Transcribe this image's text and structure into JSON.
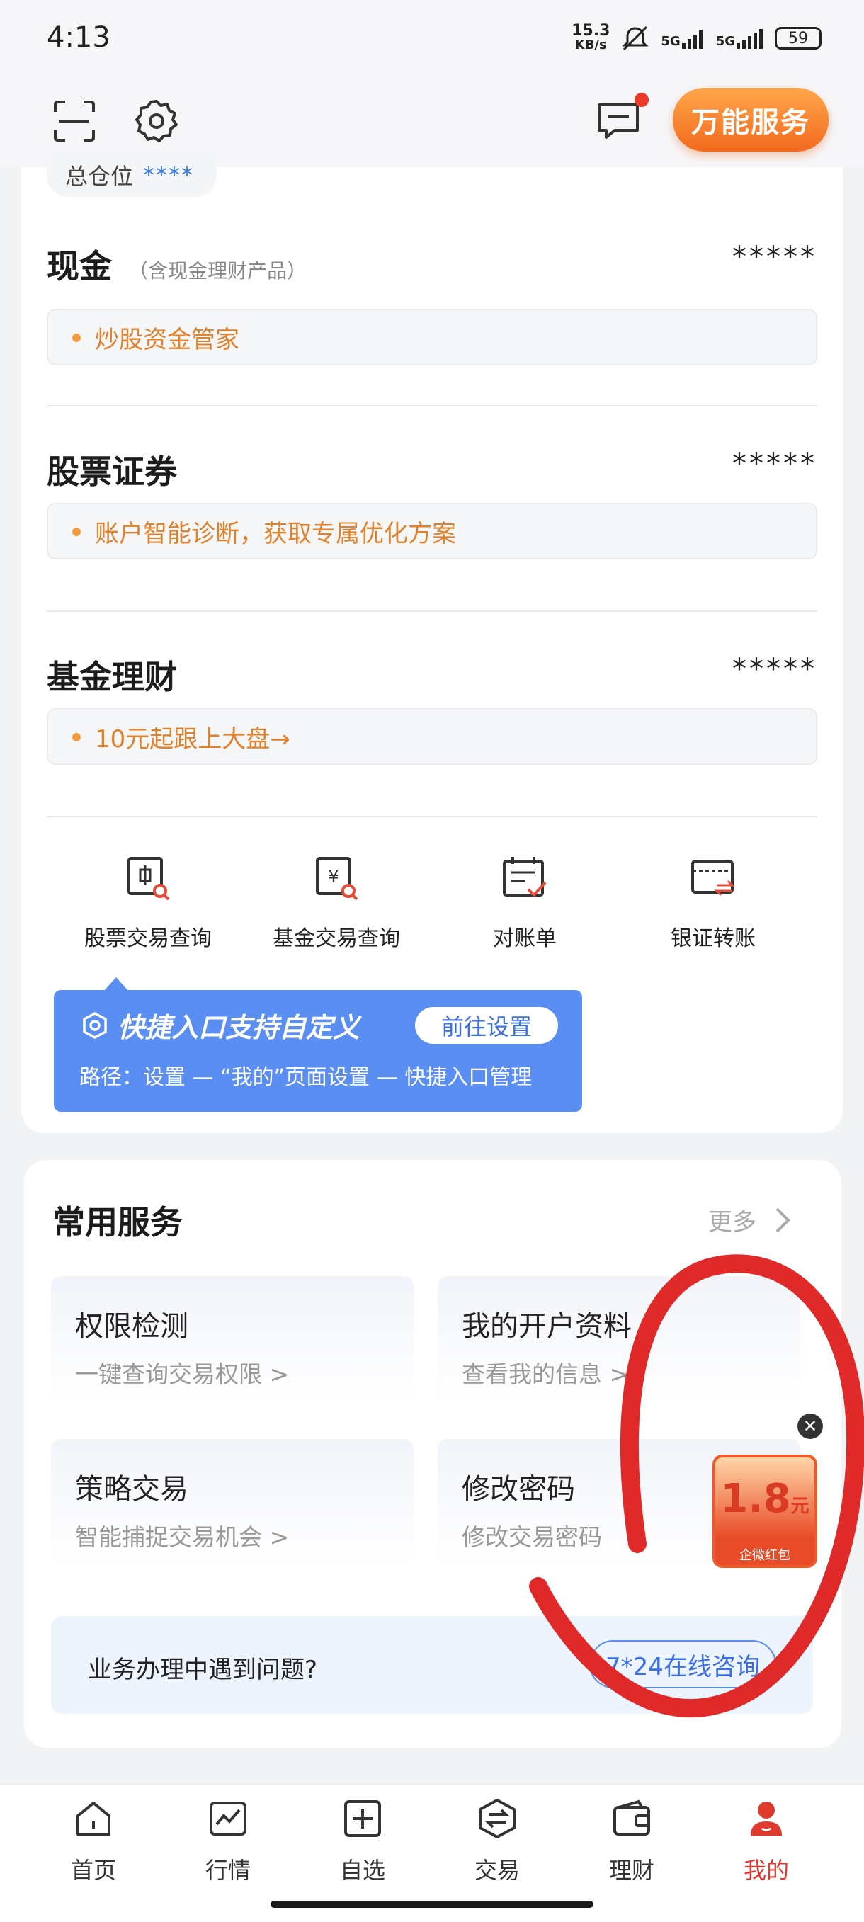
{
  "status_bar": {
    "time": "4:13",
    "net_speed_value": "15.3",
    "net_speed_unit": "KB/s",
    "signal1": "5G",
    "signal2": "5G",
    "battery": "59"
  },
  "top_bar": {
    "service_button": "万能服务"
  },
  "position_chip": {
    "label": "总仓位",
    "value": "****"
  },
  "sections": [
    {
      "title": "现金",
      "subtitle": "（含现金理财产品）",
      "value": "*****",
      "tip": "炒股资金管家"
    },
    {
      "title": "股票证券",
      "subtitle": "",
      "value": "*****",
      "tip": "账户智能诊断，获取专属优化方案"
    },
    {
      "title": "基金理财",
      "subtitle": "",
      "value": "*****",
      "tip": "10元起跟上大盘→"
    }
  ],
  "quick_entries": [
    {
      "label": "股票交易查询",
      "icon": "stock-query-icon"
    },
    {
      "label": "基金交易查询",
      "icon": "fund-query-icon"
    },
    {
      "label": "对账单",
      "icon": "statement-icon"
    },
    {
      "label": "银证转账",
      "icon": "bank-transfer-icon"
    }
  ],
  "quick_tip": {
    "title": "快捷入口支持自定义",
    "button": "前往设置",
    "path": "路径：设置 — “我的”页面设置 — 快捷入口管理"
  },
  "services": {
    "title": "常用服务",
    "more": "更多",
    "tiles": [
      {
        "title": "权限检测",
        "sub": "一键查询交易权限 >"
      },
      {
        "title": "我的开户资料",
        "sub": "查看我的信息 >"
      },
      {
        "title": "策略交易",
        "sub": "智能捕捉交易机会 >"
      },
      {
        "title": "修改密码",
        "sub": "修改交易密码"
      }
    ],
    "help_text": "业务办理中遇到问题?",
    "help_button": "7*24在线咨询"
  },
  "red_envelope": {
    "amount": "1.8",
    "unit": "元",
    "label": "企微红包"
  },
  "bottom_nav": [
    {
      "label": "首页",
      "icon": "home-icon",
      "active": false
    },
    {
      "label": "行情",
      "icon": "market-icon",
      "active": false
    },
    {
      "label": "自选",
      "icon": "watchlist-icon",
      "active": false
    },
    {
      "label": "交易",
      "icon": "trade-icon",
      "active": false
    },
    {
      "label": "理财",
      "icon": "wealth-icon",
      "active": false
    },
    {
      "label": "我的",
      "icon": "profile-icon",
      "active": true
    }
  ],
  "colors": {
    "accent_orange": "#f36a1f",
    "tip_orange": "#e0812c",
    "blue": "#5b8ef2",
    "active_red": "#e03a2e",
    "annotation_red": "#e02a2a"
  }
}
